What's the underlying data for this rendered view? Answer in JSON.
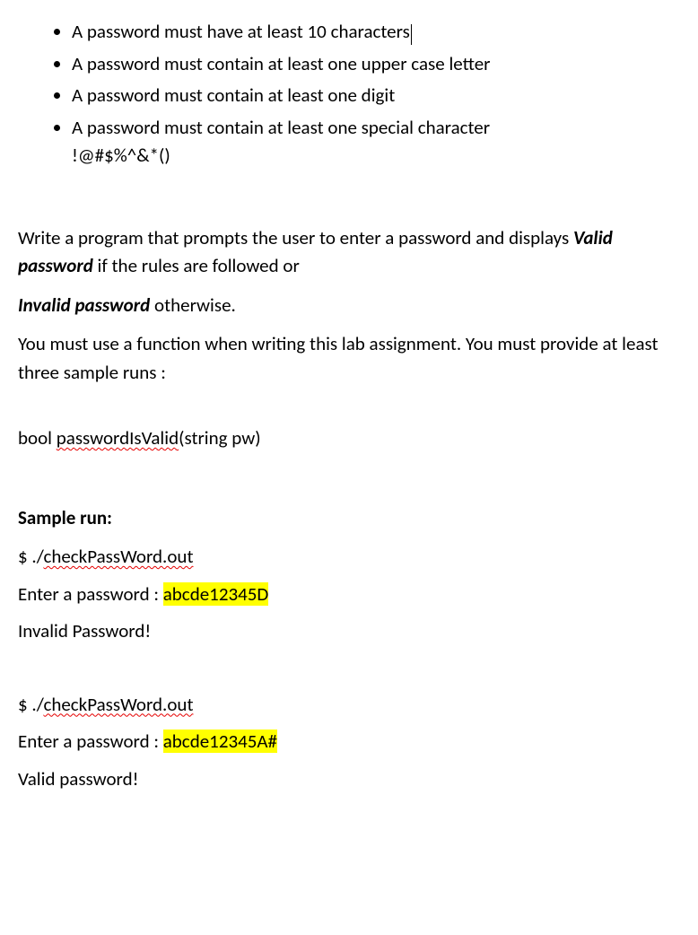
{
  "rules": {
    "item1": "A password must have at least 10 characters",
    "item2": "A password must contain at least one upper case letter",
    "item3": "A password must contain at least one digit",
    "item4_a": "A password must contain at least one special character",
    "item4_b": "!@#$%^&*()"
  },
  "intro": {
    "line1_a": "Write a program that prompts the user to enter a password and displays ",
    "valid": "Valid password",
    "line1_b": " if the rules are followed or",
    "invalid": "Invalid password",
    "line2_b": " otherwise.",
    "line3": "You must use a function when writing this lab assignment. You must provide at least three sample runs :"
  },
  "func": {
    "pre": "bool   ",
    "name": "passwordIsValid",
    "post": "(string   pw)"
  },
  "sample": {
    "heading": "Sample run:",
    "run1": {
      "cmd_pre": "$   ./",
      "cmd_name": "checkPassWord.out",
      "prompt": "Enter a password  :  ",
      "input": "abcde12345D",
      "result": "Invalid Password!"
    },
    "run2": {
      "cmd_pre": "$  ./",
      "cmd_name": "checkPassWord.out",
      "prompt": "Enter a password  :  ",
      "input": "abcde12345A#",
      "result": "Valid password!"
    }
  }
}
